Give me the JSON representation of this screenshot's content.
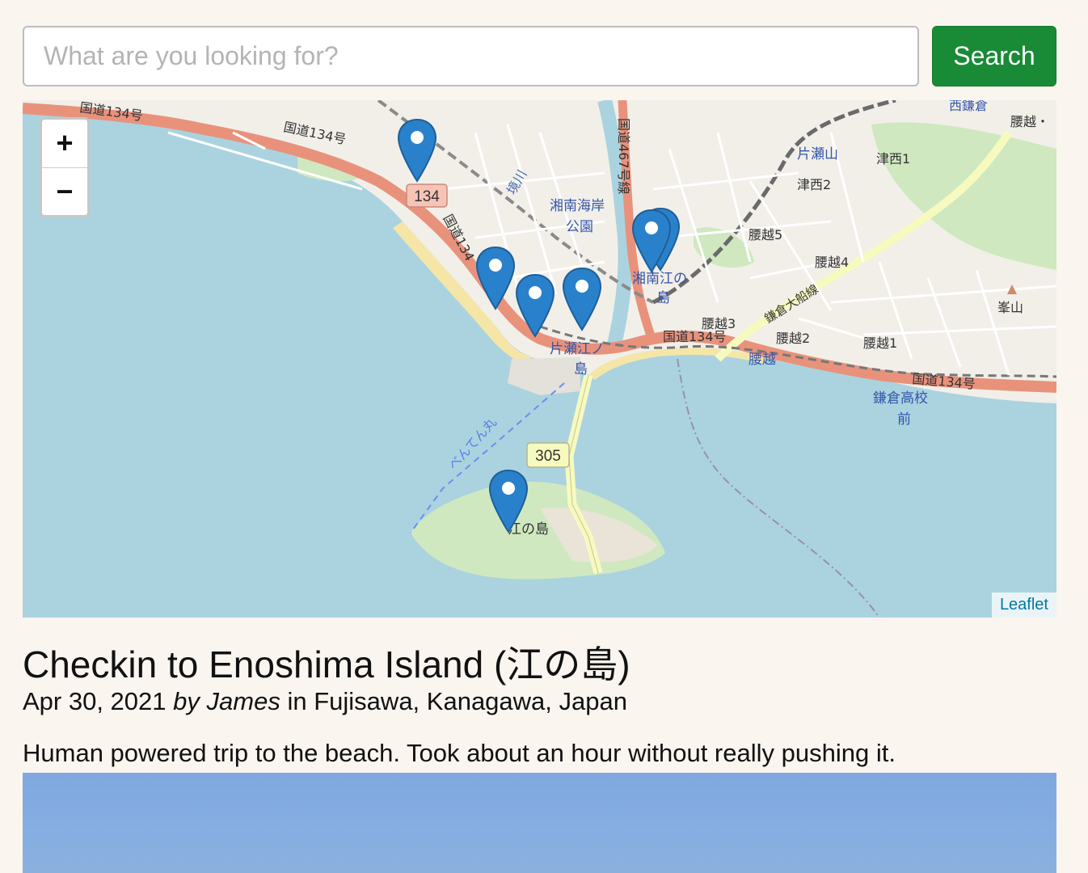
{
  "search": {
    "placeholder": "What are you looking for?",
    "button_label": "Search"
  },
  "map": {
    "zoom_in_label": "+",
    "zoom_out_label": "−",
    "attribution": "Leaflet",
    "marker_count": 7,
    "labels": {
      "route134_a": "国道134号",
      "route134_b": "国道134号",
      "route134_c": "国道134号",
      "route134_d": "国道134号",
      "route134_shield": "134",
      "route134_vertical": "国道134",
      "route467": "国道467号線",
      "route305_shield": "305",
      "shonan_kaigan_koen_1": "湘南海岸",
      "shonan_kaigan_koen_2": "公園",
      "shonan_enoshima_1": "湘南江の",
      "shonan_enoshima_2": "島",
      "katase_enoshima_1": "片瀬江ノ",
      "katase_enoshima_2": "島",
      "katase_yama": "片瀬山",
      "tsunishi1": "津西1",
      "tsunishi2": "津西2",
      "koshigoe5": "腰越5",
      "koshigoe4": "腰越4",
      "koshigoe3": "腰越3",
      "koshigoe2": "腰越2",
      "koshigoe1": "腰越1",
      "koshigoe_station": "腰越",
      "koshigoe_top": "腰越・",
      "kamakura_ofuna": "鎌倉大船線",
      "kamakura_koko_1": "鎌倉高校",
      "kamakura_koko_2": "前",
      "nishi_kamakura": "西鎌倉",
      "mineyama": "峯山",
      "enoshima": "江の島",
      "benten_maru": "べんてん丸",
      "sakaigawa": "境川"
    }
  },
  "post": {
    "title": "Checkin to Enoshima Island (江の島)",
    "date": "Apr 30, 2021",
    "by_prefix": "by",
    "author": "James",
    "location_prefix": "in",
    "location": "Fujisawa, Kanagawa, Japan",
    "description": "Human powered trip to the beach. Took about an hour without really pushing it."
  },
  "colors": {
    "background": "#faf5ee",
    "search_button": "#198a36",
    "water": "#aad3df",
    "land": "#f2efe9",
    "beach": "#f5e6a8",
    "major_road": "#e8927c",
    "secondary_road": "#f7fabf",
    "park": "#cfe8bf",
    "marker": "#2a81cb",
    "link": "#0078a8"
  }
}
